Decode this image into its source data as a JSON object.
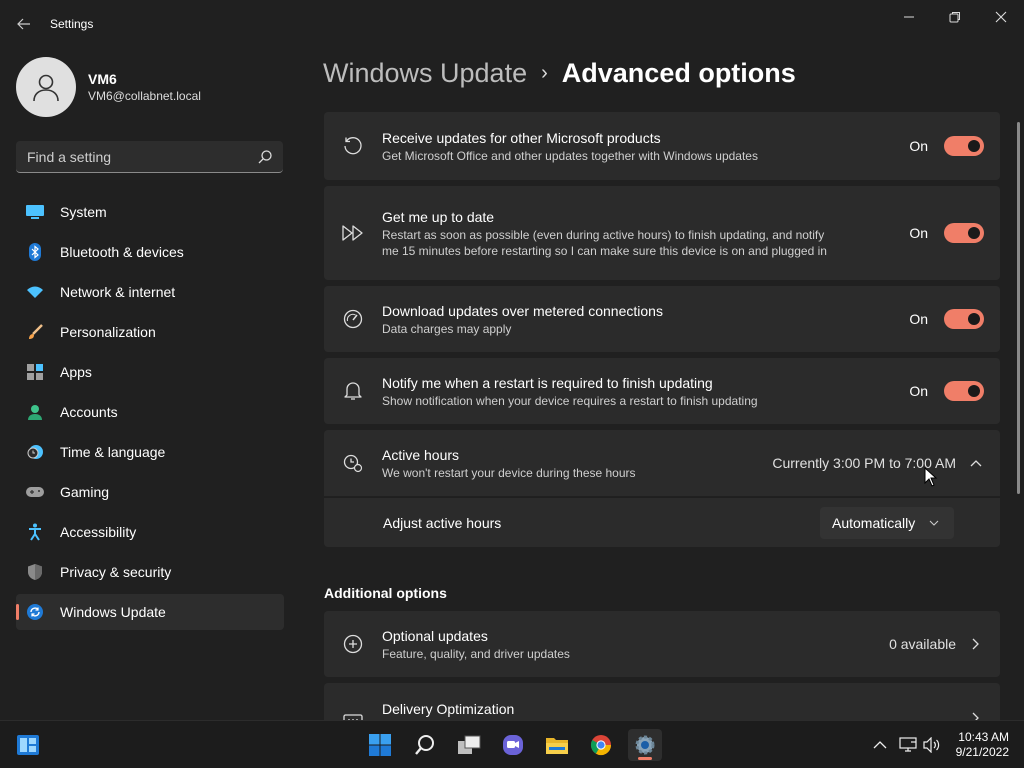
{
  "window": {
    "title": "Settings"
  },
  "profile": {
    "name": "VM6",
    "email": "VM6@collabnet.local"
  },
  "search": {
    "placeholder": "Find a setting"
  },
  "nav": {
    "items": [
      {
        "label": "System",
        "icon": "monitor-icon"
      },
      {
        "label": "Bluetooth & devices",
        "icon": "bluetooth-icon"
      },
      {
        "label": "Network & internet",
        "icon": "wifi-icon"
      },
      {
        "label": "Personalization",
        "icon": "brush-icon"
      },
      {
        "label": "Apps",
        "icon": "apps-icon"
      },
      {
        "label": "Accounts",
        "icon": "person-icon"
      },
      {
        "label": "Time & language",
        "icon": "clock-globe-icon"
      },
      {
        "label": "Gaming",
        "icon": "gamepad-icon"
      },
      {
        "label": "Accessibility",
        "icon": "accessibility-icon"
      },
      {
        "label": "Privacy & security",
        "icon": "shield-icon"
      },
      {
        "label": "Windows Update",
        "icon": "update-icon",
        "active": true
      }
    ]
  },
  "header": {
    "parent": "Windows Update",
    "separator": "›",
    "current": "Advanced options"
  },
  "settings": [
    {
      "title": "Receive updates for other Microsoft products",
      "desc": "Get Microsoft Office and other updates together with Windows updates",
      "state": "On"
    },
    {
      "title": "Get me up to date",
      "desc": "Restart as soon as possible (even during active hours) to finish updating, and notify me 15 minutes before restarting so I can make sure this device is on and plugged in",
      "state": "On"
    },
    {
      "title": "Download updates over metered connections",
      "desc": "Data charges may apply",
      "state": "On"
    },
    {
      "title": "Notify me when a restart is required to finish updating",
      "desc": "Show notification when your device requires a restart to finish updating",
      "state": "On"
    }
  ],
  "active_hours": {
    "title": "Active hours",
    "desc": "We won't restart your device during these hours",
    "value": "Currently 3:00 PM to 7:00 AM",
    "adjust_label": "Adjust active hours",
    "adjust_value": "Automatically"
  },
  "additional": {
    "heading": "Additional options",
    "items": [
      {
        "title": "Optional updates",
        "desc": "Feature, quality, and driver updates",
        "value": "0 available"
      },
      {
        "title": "Delivery Optimization",
        "desc": "",
        "value": ""
      }
    ]
  },
  "taskbar": {
    "time": "10:43 AM",
    "date": "9/21/2022"
  },
  "colors": {
    "accent": "#f07e68",
    "background": "#202020",
    "card": "#2b2b2b"
  }
}
